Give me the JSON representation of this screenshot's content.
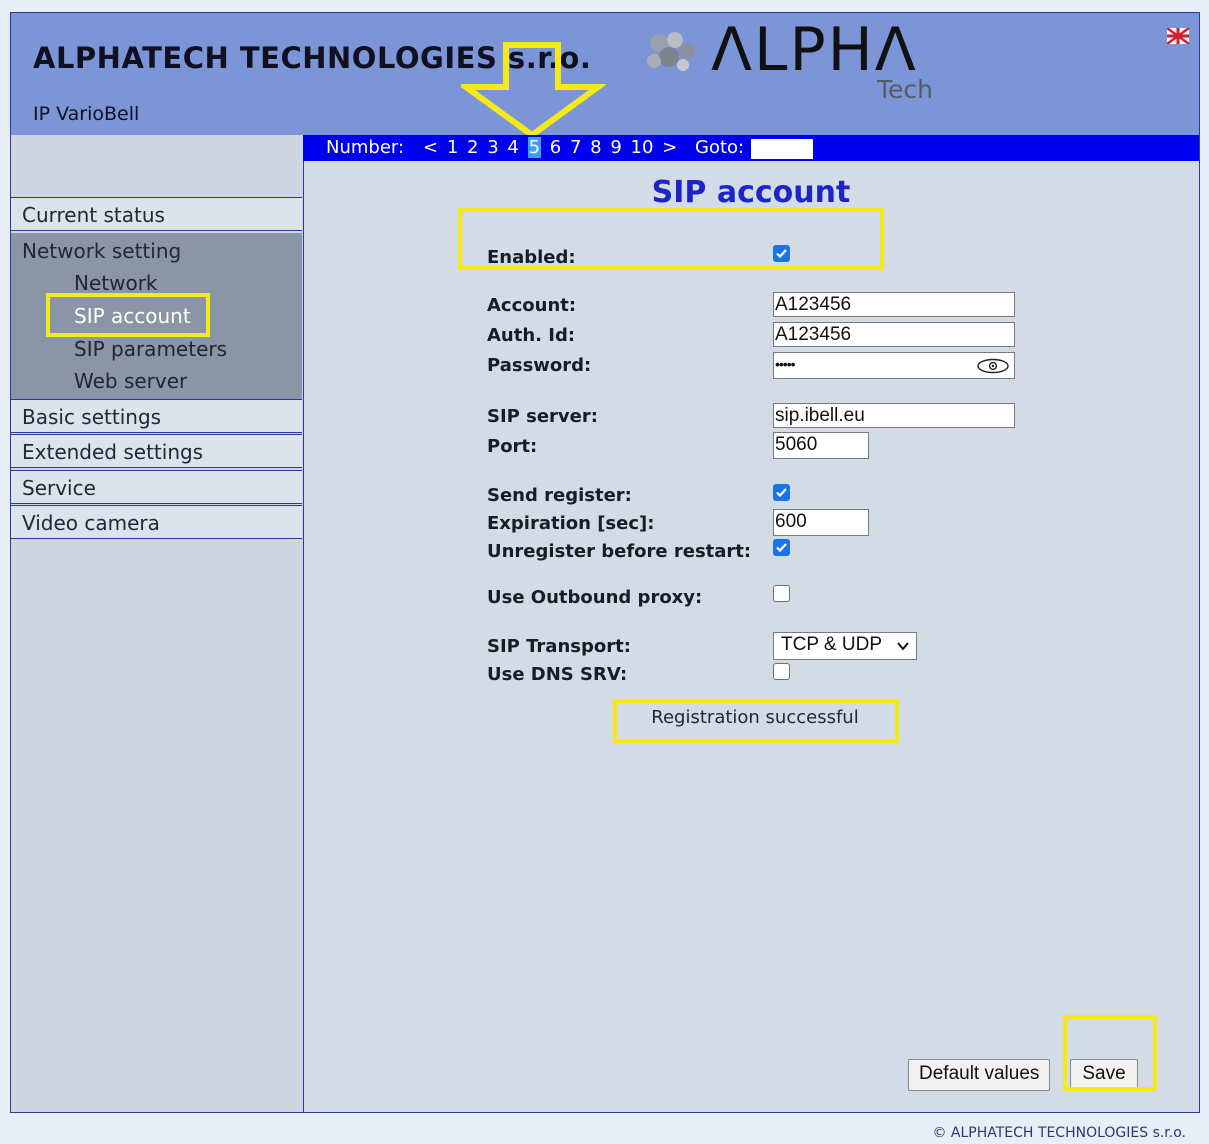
{
  "header": {
    "company": "ALPHATECH TECHNOLOGIES s.r.o.",
    "product": "IP VarioBell",
    "logo_text": "ΛLPHΛ",
    "logo_sub": "Tech"
  },
  "sidebar": {
    "items": [
      {
        "label": "Current status"
      },
      {
        "label": "Network setting"
      },
      {
        "label": "Basic settings"
      },
      {
        "label": "Extended settings"
      },
      {
        "label": "Service"
      },
      {
        "label": "Video camera"
      }
    ],
    "network_sub": [
      {
        "label": "Network"
      },
      {
        "label": "SIP account"
      },
      {
        "label": "SIP parameters"
      },
      {
        "label": "Web server"
      }
    ]
  },
  "nav": {
    "number_label": "Number:",
    "prev": "<",
    "next": ">",
    "numbers": [
      "1",
      "2",
      "3",
      "4",
      "5",
      "6",
      "7",
      "8",
      "9",
      "10"
    ],
    "selected": "5",
    "goto_label": "Goto:",
    "goto_value": ""
  },
  "form": {
    "title": "SIP account",
    "enabled_label": "Enabled:",
    "enabled": true,
    "account_label": "Account:",
    "account_value": "A123456",
    "authid_label": "Auth. Id:",
    "authid_value": "A123456",
    "password_label": "Password:",
    "password_value": "•••••",
    "sipserver_label": "SIP server:",
    "sipserver_value": "sip.ibell.eu",
    "port_label": "Port:",
    "port_value": "5060",
    "sendreg_label": "Send register:",
    "sendreg": true,
    "expiration_label": "Expiration [sec]:",
    "expiration_value": "600",
    "unreg_label": "Unregister before restart:",
    "unreg": true,
    "outbound_label": "Use Outbound proxy:",
    "outbound": false,
    "transport_label": "SIP Transport:",
    "transport_value": "TCP & UDP",
    "dnssrv_label": "Use DNS SRV:",
    "dnssrv": false,
    "status": "Registration successful"
  },
  "buttons": {
    "default_label": "Default values",
    "save_label": "Save"
  },
  "footer": "© ALPHATECH TECHNOLOGIES s.r.o.",
  "colors": {
    "header": "#7b95d6",
    "navbar": "#0000f0",
    "title": "#1c26c8",
    "highlight": "#f5ea18",
    "checkbox": "#1a73e8"
  }
}
